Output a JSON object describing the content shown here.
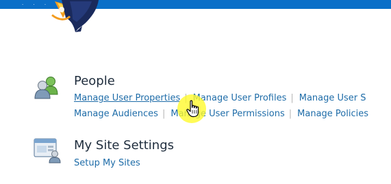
{
  "banner": {
    "brand_color": "#0b6fc8",
    "dots": "· · ·"
  },
  "logo": {
    "icon": "rocket-icon"
  },
  "sections": {
    "people": {
      "icon": "people-icon",
      "title": "People",
      "links_row1": {
        "manage_user_properties": "Manage User Properties",
        "manage_user_profiles": "Manage User Profiles",
        "manage_user_sub_truncated": "Manage User S"
      },
      "links_row2": {
        "manage_audiences": "Manage Audiences",
        "manage_user_permissions": "Manage User Permissions",
        "manage_policies": "Manage Policies"
      },
      "separator": "|"
    },
    "my_site_settings": {
      "icon": "site-settings-icon",
      "title": "My Site Settings",
      "links": {
        "setup_my_sites": "Setup My Sites"
      }
    }
  },
  "cursor": {
    "type": "hand-pointer-icon",
    "highlight_color": "#fffa28"
  },
  "colors": {
    "link": "#1e6ca8",
    "title": "#1f2d3d",
    "separator": "#b8b8b8"
  }
}
